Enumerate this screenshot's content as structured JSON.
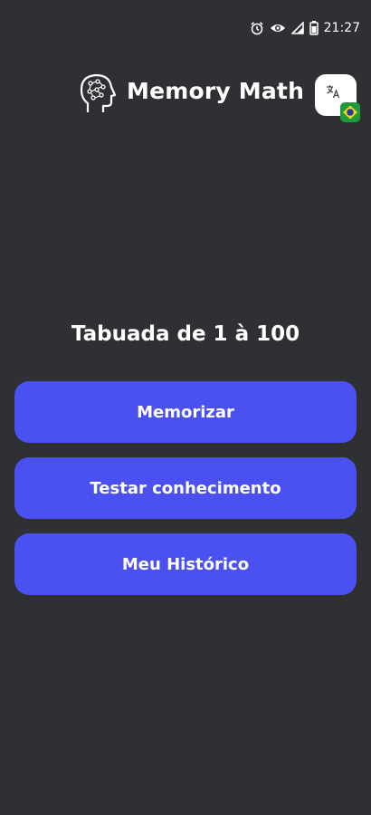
{
  "status_bar": {
    "time": "21:27",
    "icons": [
      "alarm-icon",
      "eye-icon",
      "signal-icon",
      "battery-icon"
    ]
  },
  "header": {
    "title": "Memory Math",
    "logo_icon": "brain-icon",
    "language_icon": "translate-icon",
    "flag": "brazil-flag"
  },
  "main": {
    "subtitle": "Tabuada de 1 à 100",
    "buttons": [
      {
        "label": "Memorizar"
      },
      {
        "label": "Testar conhecimento"
      },
      {
        "label": "Meu Histórico"
      }
    ]
  },
  "colors": {
    "background": "#2f3033",
    "accent": "#4b51f1",
    "text": "#ffffff"
  }
}
